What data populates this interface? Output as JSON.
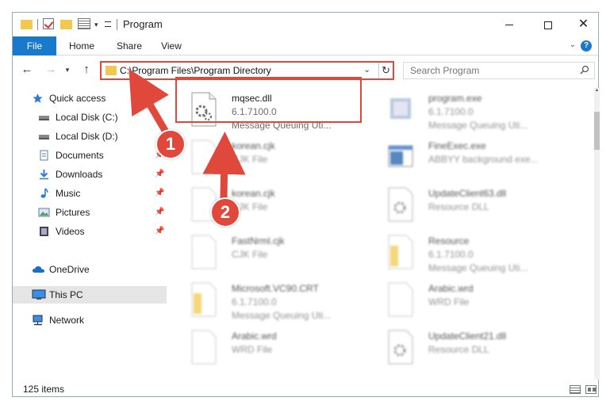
{
  "window": {
    "title": "Program",
    "minimize_icon": "minimize-icon",
    "maximize_icon": "maximize-icon",
    "close_icon": "close-icon"
  },
  "ribbon": {
    "tabs": [
      "File",
      "Home",
      "Share",
      "View"
    ],
    "active_tab": "File",
    "help_label": "?"
  },
  "nav": {
    "address": "C:\\Program Files\\Program Directory",
    "search_placeholder": "Search Program"
  },
  "sidebar": {
    "items": [
      {
        "label": "Quick access",
        "icon": "star-icon"
      },
      {
        "label": "Local Disk (C:)",
        "icon": "drive-icon"
      },
      {
        "label": "Local Disk (D:)",
        "icon": "drive-icon"
      },
      {
        "label": "Documents",
        "icon": "documents-icon",
        "pinned": true
      },
      {
        "label": "Downloads",
        "icon": "downloads-icon",
        "pinned": true
      },
      {
        "label": "Music",
        "icon": "music-icon",
        "pinned": true
      },
      {
        "label": "Pictures",
        "icon": "pictures-icon",
        "pinned": true
      },
      {
        "label": "Videos",
        "icon": "videos-icon",
        "pinned": true
      },
      {
        "label": "OneDrive",
        "icon": "cloud-icon"
      },
      {
        "label": "This PC",
        "icon": "computer-icon",
        "selected": true
      },
      {
        "label": "Network",
        "icon": "network-icon"
      }
    ]
  },
  "files": {
    "left": [
      {
        "name": "mqsec.dll",
        "line1": "6.1.7100.0",
        "line2": "Message Queuing Uti...",
        "icon": "dll-icon",
        "highlighted": true
      },
      {
        "name": "korean.cjk",
        "line1": "CJK File",
        "line2": "",
        "icon": "file-icon"
      },
      {
        "name": "korean.cjk",
        "line1": "CJK File",
        "line2": "",
        "icon": "file-icon"
      },
      {
        "name": "FastNrml.cjk",
        "line1": "CJK File",
        "line2": "",
        "icon": "file-icon"
      },
      {
        "name": "Microsoft.VC90.CRT",
        "line1": "6.1.7100.0",
        "line2": "Message Queuing Uti...",
        "icon": "folder-icon"
      },
      {
        "name": "Arabic.wrd",
        "line1": "WRD File",
        "line2": "",
        "icon": "file-icon"
      }
    ],
    "right": [
      {
        "name": "program.exe",
        "line1": "6.1.7100.0",
        "line2": "Message Queuing Uti...",
        "icon": "exe-icon"
      },
      {
        "name": "FineExec.exe",
        "line1": "ABBYY background exe...",
        "line2": "",
        "icon": "app-icon"
      },
      {
        "name": "UpdateClient63.dll",
        "line1": "Resource DLL",
        "line2": "",
        "icon": "dll-icon"
      },
      {
        "name": "Resource",
        "line1": "6.1.7100.0",
        "line2": "Message Queuing Uti...",
        "icon": "folder-icon"
      },
      {
        "name": "Arabic.wrd",
        "line1": "WRD File",
        "line2": "",
        "icon": "file-icon"
      },
      {
        "name": "UpdateClient21.dll",
        "line1": "Resource DLL",
        "line2": "",
        "icon": "dll-icon"
      }
    ]
  },
  "status": {
    "item_count": "125 items"
  },
  "annotations": {
    "badge_1": "1",
    "badge_2": "2",
    "color": "#e0483b"
  }
}
